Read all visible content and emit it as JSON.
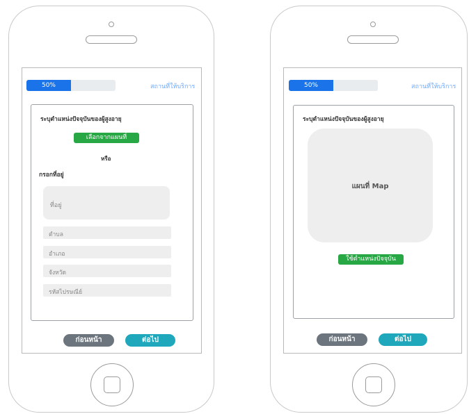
{
  "progress": {
    "percent": 50,
    "label": "50%"
  },
  "header": {
    "step_link": "สถานที่ให้บริการ"
  },
  "form_screen": {
    "title": "ระบุตำแหน่งปัจจุบันของผู้สูงอายุ",
    "select_map_button": "เลือกจากแผนที่",
    "or_label": "หรือ",
    "address_section_label": "กรอกที่อยู่",
    "address_placeholder": "ที่อยู่",
    "subdistrict_placeholder": "ตำบล",
    "district_placeholder": "อำเภอ",
    "province_placeholder": "จังหวัด",
    "postal_placeholder": "รหัสไปรษณีย์"
  },
  "map_screen": {
    "title": "ระบุตำแหน่งปัจจุบันของผู้สูงอายุ",
    "map_label": "แผนที่ Map",
    "use_current_button": "ใช้ตำแหน่งปัจจุบัน"
  },
  "footer": {
    "back_label": "ก่อนหน้า",
    "next_label": "ต่อไป"
  },
  "colors": {
    "progress_fill": "#1a73e8",
    "green_button": "#28a745",
    "back_button": "#6c757d",
    "next_button": "#1fa7bc",
    "link": "#6ea8fe"
  }
}
